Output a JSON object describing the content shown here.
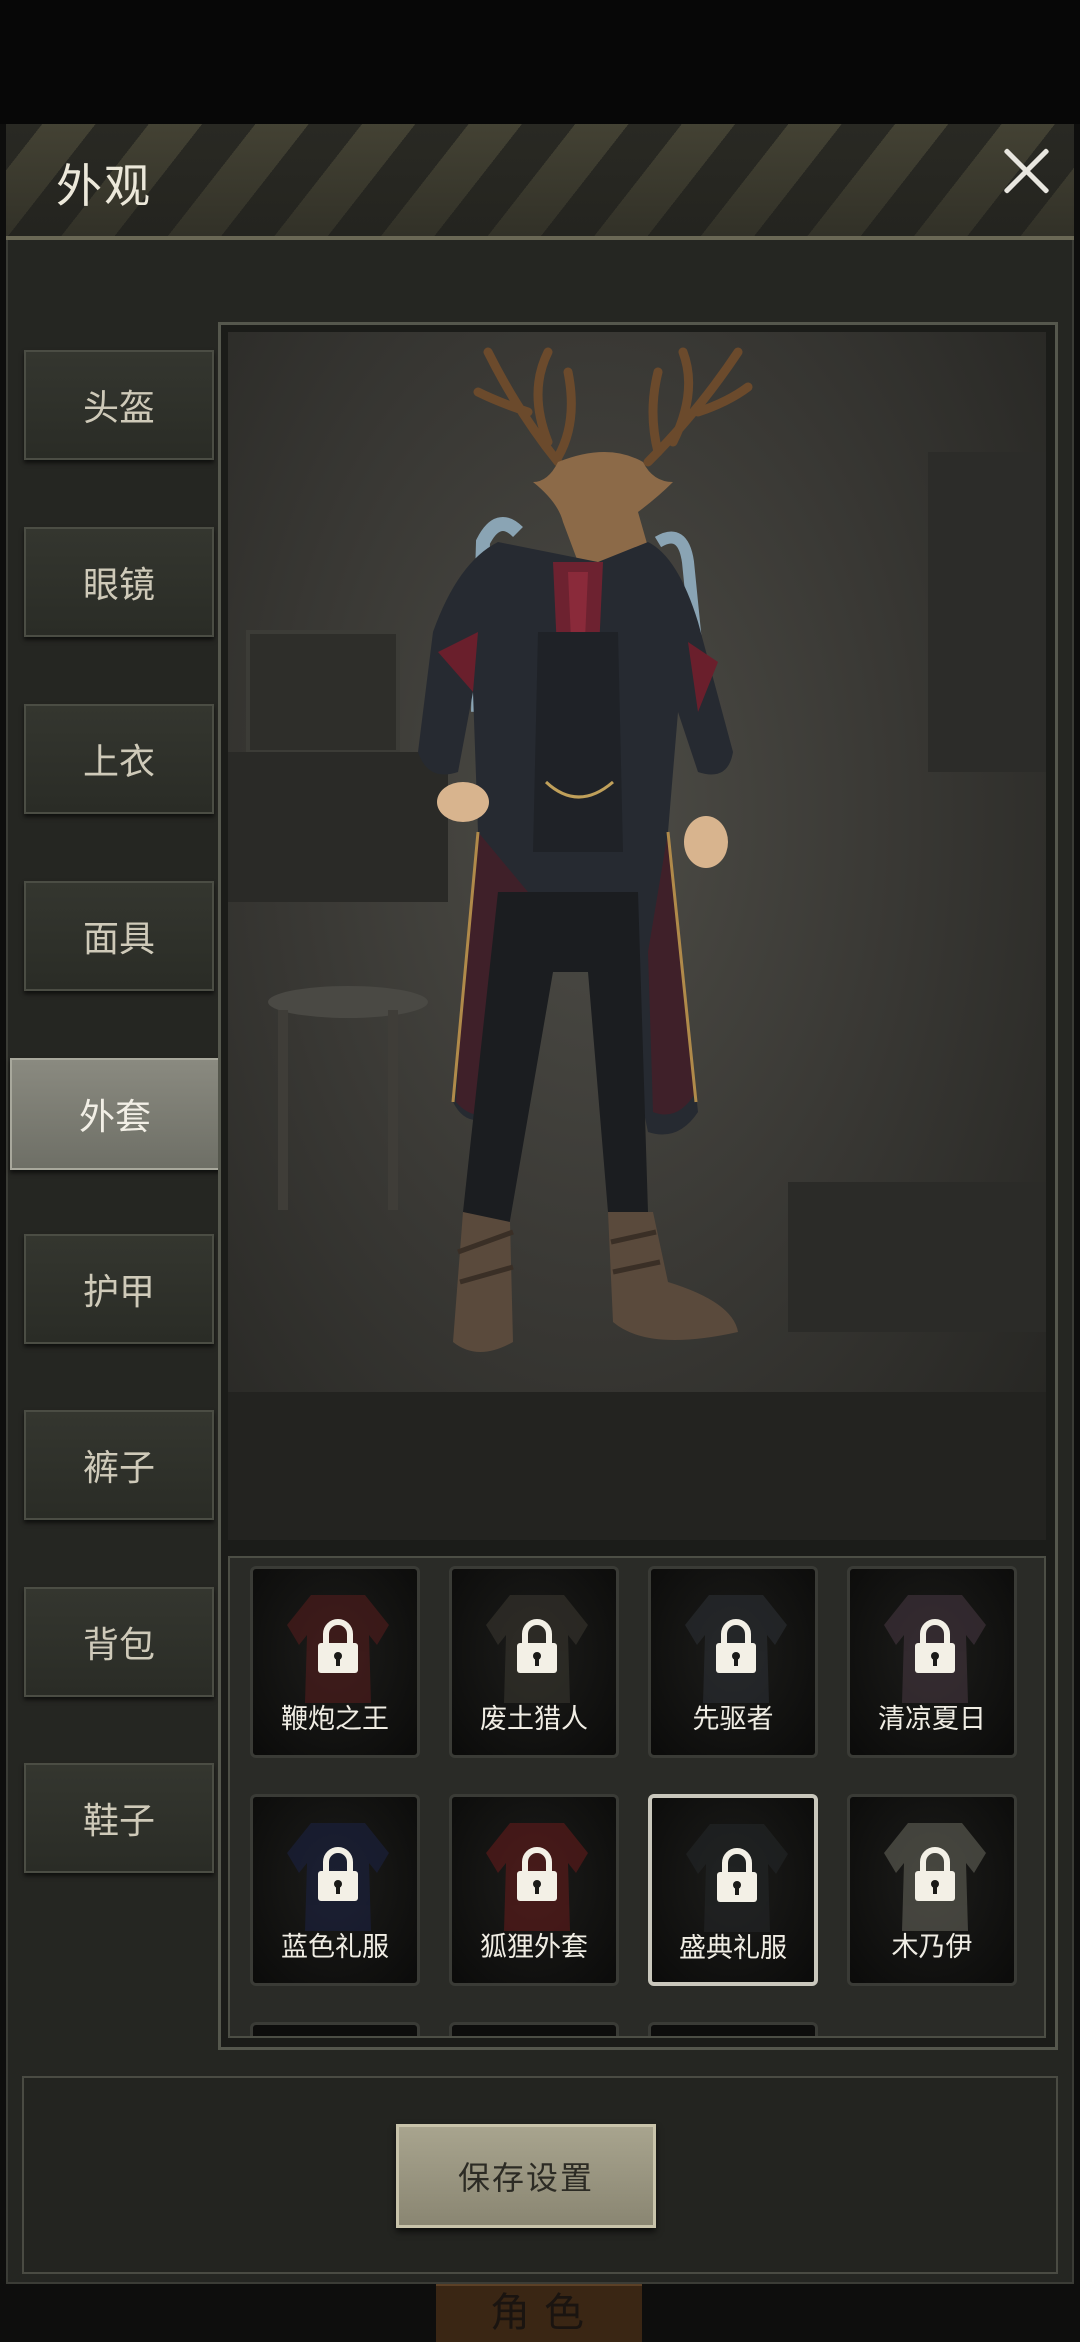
{
  "header": {
    "title": "外观"
  },
  "tabs": [
    {
      "label": "头盔",
      "active": false
    },
    {
      "label": "眼镜",
      "active": false
    },
    {
      "label": "上衣",
      "active": false
    },
    {
      "label": "面具",
      "active": false
    },
    {
      "label": "外套",
      "active": true
    },
    {
      "label": "护甲",
      "active": false
    },
    {
      "label": "裤子",
      "active": false
    },
    {
      "label": "背包",
      "active": false
    },
    {
      "label": "鞋子",
      "active": false
    }
  ],
  "items": [
    {
      "name": "鞭炮之王",
      "locked": true,
      "selected": false,
      "color": "#5a1e1e"
    },
    {
      "name": "废土猎人",
      "locked": true,
      "selected": false,
      "color": "#3c3a32"
    },
    {
      "name": "先驱者",
      "locked": true,
      "selected": false,
      "color": "#2e3238"
    },
    {
      "name": "清凉夏日",
      "locked": true,
      "selected": false,
      "color": "#4a3a44"
    },
    {
      "name": "蓝色礼服",
      "locked": true,
      "selected": false,
      "color": "#1d2346"
    },
    {
      "name": "狐狸外套",
      "locked": true,
      "selected": false,
      "color": "#6a1c1c"
    },
    {
      "name": "盛典礼服",
      "locked": true,
      "selected": true,
      "color": "#26282a"
    },
    {
      "name": "木乃伊",
      "locked": true,
      "selected": false,
      "color": "#6b6a60"
    }
  ],
  "footer": {
    "save_label": "保存设置",
    "under_tab_label": "角色"
  },
  "colors": {
    "accent": "#a8a48e",
    "panel": "#252622",
    "active_tab": "#7c7c73"
  }
}
